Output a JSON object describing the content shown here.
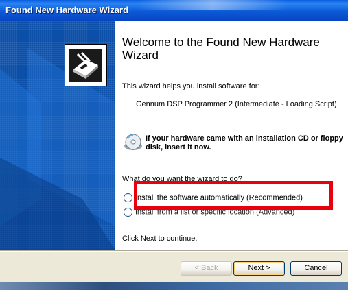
{
  "window": {
    "title": "Found New Hardware Wizard"
  },
  "content": {
    "heading": "Welcome to the Found New Hardware Wizard",
    "intro": "This wizard helps you install software for:",
    "device_name": "Gennum DSP Programmer 2 (Intermediate - Loading Script)",
    "cd_prompt": "If your hardware came with an installation CD or floppy disk, insert it now.",
    "question": "What do you want the wizard to do?",
    "options": [
      {
        "label": "Install the software automatically (Recommended)",
        "selected": false
      },
      {
        "label": "Install from a list or specific location (Advanced)",
        "selected": false
      }
    ],
    "footer": "Click Next to continue."
  },
  "buttons": {
    "back": "< Back",
    "next": "Next >",
    "cancel": "Cancel"
  },
  "colors": {
    "titlebar": "#0b5ad8",
    "banner": "#0b4fa8",
    "highlight": "#e8000d",
    "dialog_bg": "#ece9d8"
  }
}
